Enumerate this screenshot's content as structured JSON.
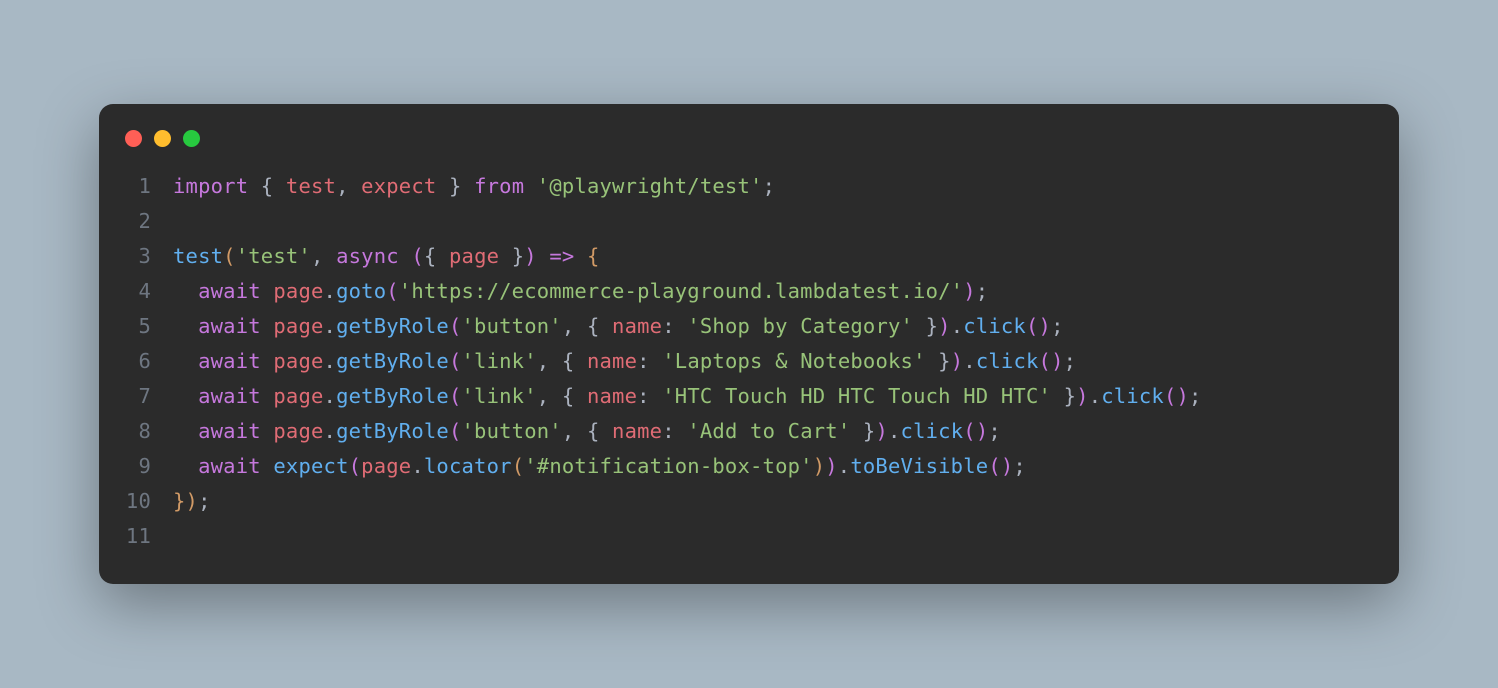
{
  "lines": {
    "n1": "1",
    "n2": "2",
    "n3": "3",
    "n4": "4",
    "n5": "5",
    "n6": "6",
    "n7": "7",
    "n8": "8",
    "n9": "9",
    "n10": "10",
    "n11": "11"
  },
  "l1": {
    "import": "import",
    "lbrace": " { ",
    "test": "test",
    "comma": ", ",
    "expect": "expect",
    "rbrace": " } ",
    "from": "from",
    "sp": " ",
    "str": "'@playwright/test'",
    "semi": ";"
  },
  "l3": {
    "test": "test",
    "lparen": "(",
    "str": "'test'",
    "comma": ", ",
    "async": "async",
    "sp": " ",
    "lparen2": "(",
    "lbrace": "{ ",
    "page": "page",
    "rbrace": " }",
    "rparen2": ")",
    "sp2": " ",
    "arrow": "=>",
    "sp3": " ",
    "obrace": "{"
  },
  "l4": {
    "indent": "  ",
    "await": "await",
    "sp": " ",
    "page": "page",
    "dot": ".",
    "goto": "goto",
    "lparen": "(",
    "str": "'https://ecommerce-playground.lambdatest.io/'",
    "rparen": ")",
    "semi": ";"
  },
  "l5": {
    "indent": "  ",
    "await": "await",
    "sp": " ",
    "page": "page",
    "dot": ".",
    "getByRole": "getByRole",
    "lparen": "(",
    "str1": "'button'",
    "comma": ", ",
    "lbrace": "{ ",
    "name": "name",
    "colon": ": ",
    "str2": "'Shop by Category'",
    "rbrace": " }",
    "rparen": ")",
    "dot2": ".",
    "click": "click",
    "lparen2": "(",
    "rparen2": ")",
    "semi": ";"
  },
  "l6": {
    "indent": "  ",
    "await": "await",
    "sp": " ",
    "page": "page",
    "dot": ".",
    "getByRole": "getByRole",
    "lparen": "(",
    "str1": "'link'",
    "comma": ", ",
    "lbrace": "{ ",
    "name": "name",
    "colon": ": ",
    "str2": "'Laptops & Notebooks'",
    "rbrace": " }",
    "rparen": ")",
    "dot2": ".",
    "click": "click",
    "lparen2": "(",
    "rparen2": ")",
    "semi": ";"
  },
  "l7": {
    "indent": "  ",
    "await": "await",
    "sp": " ",
    "page": "page",
    "dot": ".",
    "getByRole": "getByRole",
    "lparen": "(",
    "str1": "'link'",
    "comma": ", ",
    "lbrace": "{ ",
    "name": "name",
    "colon": ": ",
    "str2": "'HTC Touch HD HTC Touch HD HTC'",
    "rbrace": " }",
    "rparen": ")",
    "dot2": ".",
    "click": "click",
    "lparen2": "(",
    "rparen2": ")",
    "semi": ";"
  },
  "l8": {
    "indent": "  ",
    "await": "await",
    "sp": " ",
    "page": "page",
    "dot": ".",
    "getByRole": "getByRole",
    "lparen": "(",
    "str1": "'button'",
    "comma": ", ",
    "lbrace": "{ ",
    "name": "name",
    "colon": ": ",
    "str2": "'Add to Cart'",
    "rbrace": " }",
    "rparen": ")",
    "dot2": ".",
    "click": "click",
    "lparen2": "(",
    "rparen2": ")",
    "semi": ";"
  },
  "l9": {
    "indent": "  ",
    "await": "await",
    "sp": " ",
    "expect": "expect",
    "lparen": "(",
    "page": "page",
    "dot": ".",
    "locator": "locator",
    "lparen2": "(",
    "str": "'#notification-box-top'",
    "rparen2": ")",
    "rparen": ")",
    "dot2": ".",
    "toBeVisible": "toBeVisible",
    "lparen3": "(",
    "rparen3": ")",
    "semi": ";"
  },
  "l10": {
    "cbrace": "}",
    "rparen": ")",
    "semi": ";"
  }
}
